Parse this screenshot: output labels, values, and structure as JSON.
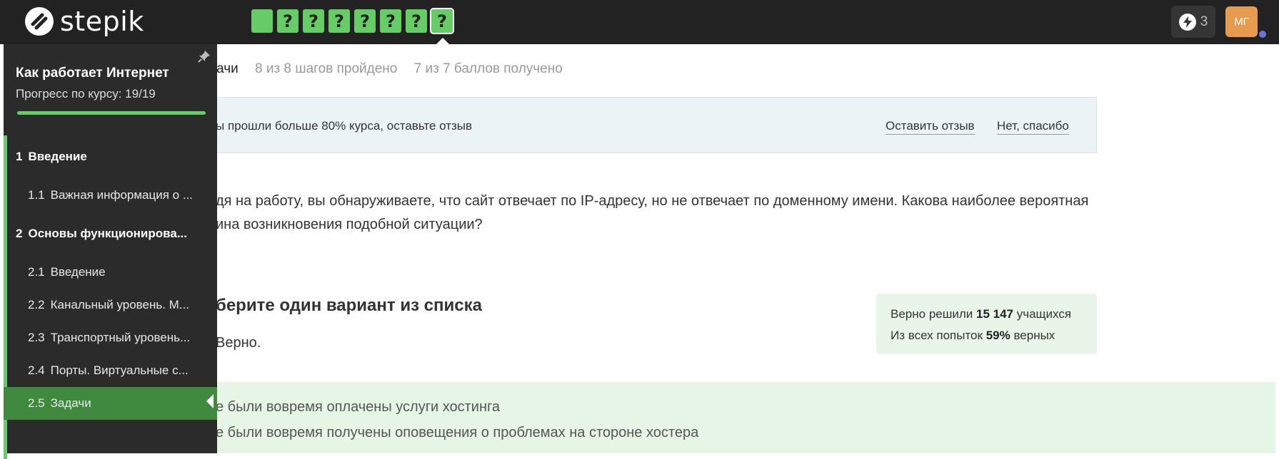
{
  "brand": {
    "name": "stepik"
  },
  "steps": [
    {
      "label": "",
      "state": "done"
    },
    {
      "label": "?",
      "state": "question"
    },
    {
      "label": "?",
      "state": "question"
    },
    {
      "label": "?",
      "state": "question"
    },
    {
      "label": "?",
      "state": "question"
    },
    {
      "label": "?",
      "state": "question"
    },
    {
      "label": "?",
      "state": "question"
    },
    {
      "label": "?",
      "state": "current"
    }
  ],
  "topbar": {
    "energy_count": "3",
    "avatar_initials": "МГ"
  },
  "sidebar": {
    "course_title": "Как работает Интернет",
    "progress_label": "Прогресс по курсу:  19/19",
    "progress_value": 1.0,
    "items": [
      {
        "num": "1",
        "label": "Введение",
        "type": "section"
      },
      {
        "num": "1.1",
        "label": "Важная информация о ...",
        "type": "lesson"
      },
      {
        "num": "2",
        "label": "Основы функционирова...",
        "type": "section"
      },
      {
        "num": "2.1",
        "label": "Введение",
        "type": "lesson"
      },
      {
        "num": "2.2",
        "label": "Канальный уровень. М...",
        "type": "lesson"
      },
      {
        "num": "2.3",
        "label": "Транспортный уровень...",
        "type": "lesson"
      },
      {
        "num": "2.4",
        "label": "Порты. Виртуальные с...",
        "type": "lesson"
      },
      {
        "num": "2.5",
        "label": "Задачи",
        "type": "lesson",
        "active": true
      }
    ]
  },
  "lesson_header": {
    "title": "дачи",
    "steps_passed": "8 из 8 шагов пройдено",
    "points": "7 из 7 баллов  получено"
  },
  "banner": {
    "text": "ы прошли больше 80% курса, оставьте отзыв",
    "leave_review": "Оставить отзыв",
    "no_thanks": "Нет, спасибо"
  },
  "question": {
    "line1": "дя на работу, вы обнаруживаете, что сайт отвечает по IP-адресу, но не отвечает по доменному имени. Какова наиболее вероятная",
    "line2": "ина возникновения подобной ситуации?"
  },
  "task": {
    "choose_title": "берите один вариант из списка",
    "verdict": "Верно."
  },
  "stats": {
    "solved_prefix": "Верно решили ",
    "solved_count": "15 147",
    "solved_suffix": " учащихся",
    "attempts_prefix": "Из всех попыток ",
    "attempts_percent": "59%",
    "attempts_suffix": " верных"
  },
  "answers": [
    "е были вовремя оплачены услуги хостинга",
    "е были вовремя получены оповещения о проблемах на стороне хостера"
  ],
  "colors": {
    "topbar": "#222222",
    "sidebar": "#2b2b2b",
    "accent_green": "#66cc66",
    "active_item": "#3f8a3f",
    "avatar": "#e69b4f",
    "banner_bg": "#ebf3f7",
    "answers_bg": "#e6f5e6"
  }
}
